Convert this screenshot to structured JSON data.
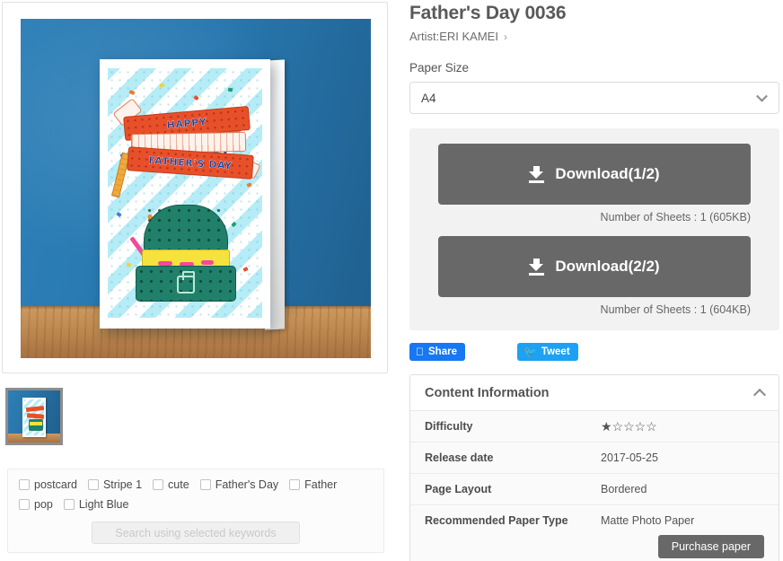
{
  "product": {
    "title": "Father's Day 0036",
    "artist_label": "Artist:ERI KAMEI",
    "artist_chevron": "›"
  },
  "paper_size": {
    "label": "Paper Size",
    "value": "A4",
    "options": [
      "A4"
    ]
  },
  "downloads": [
    {
      "button_label": "Download(1/2)",
      "sheets_text": "Number of Sheets : 1 (605KB)"
    },
    {
      "button_label": "Download(2/2)",
      "sheets_text": "Number of Sheets : 1 (604KB)"
    }
  ],
  "social": {
    "facebook_label": "Share",
    "facebook_icon": "f",
    "facebook_color": "#1877f2",
    "twitter_label": "Tweet",
    "twitter_icon": "✈",
    "twitter_color": "#1da1f2"
  },
  "content_information": {
    "heading": "Content Information",
    "rows": [
      {
        "key": "Difficulty",
        "value": "★☆☆☆☆"
      },
      {
        "key": "Release date",
        "value": "2017-05-25"
      },
      {
        "key": "Page Layout",
        "value": "Bordered"
      },
      {
        "key": "Recommended Paper Type",
        "value": "Matte Photo Paper"
      }
    ],
    "purchase_label": "Purchase paper"
  },
  "keywords": {
    "items": [
      {
        "label": "postcard",
        "checked": false
      },
      {
        "label": "Stripe 1",
        "checked": false
      },
      {
        "label": "cute",
        "checked": false
      },
      {
        "label": "Father's Day",
        "checked": false
      },
      {
        "label": "Father",
        "checked": false
      },
      {
        "label": "pop",
        "checked": false
      },
      {
        "label": "Light Blue",
        "checked": false
      }
    ],
    "search_label": "Search using selected keywords",
    "search_enabled": false
  },
  "preview": {
    "card_line1": "HAPPY",
    "card_line2": "FATHER'S DAY",
    "wall_color": "#2878b0",
    "table_color": "#c08b52",
    "ribbon_color": "#e8502a",
    "toolbox_color": "#21806a",
    "tray_color": "#f5e23c",
    "stripe_color": "#b6ecf6"
  }
}
